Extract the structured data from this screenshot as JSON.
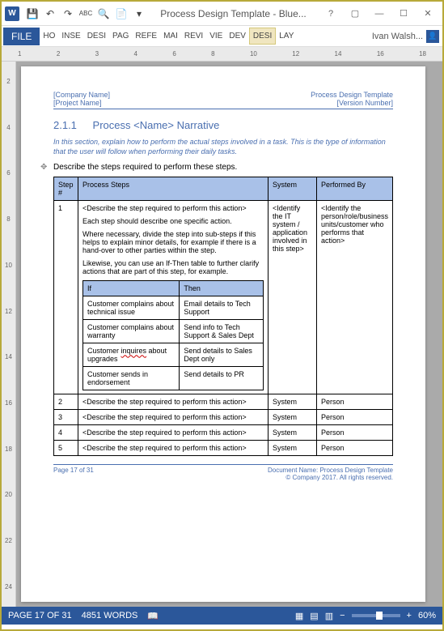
{
  "titlebar": {
    "title": "Process Design Template - Blue..."
  },
  "ribbon": {
    "file": "FILE",
    "tabs": [
      "HO",
      "INSE",
      "DESI",
      "PAG",
      "REFE",
      "MAI",
      "REVI",
      "VIE",
      "DEV",
      "DESI",
      "LAY"
    ],
    "user": "Ivan Walsh..."
  },
  "ruler_h": [
    "1",
    "2",
    "3",
    "4",
    "6",
    "8",
    "10",
    "12",
    "14",
    "16",
    "18"
  ],
  "ruler_v": [
    "2",
    "4",
    "6",
    "8",
    "10",
    "12",
    "14",
    "16",
    "18",
    "20",
    "22",
    "24"
  ],
  "doc": {
    "header": {
      "left1": "[Company Name]",
      "left2": "[Project Name]",
      "right1": "Process Design Template",
      "right2": "[Version Number]"
    },
    "section_num": "2.1.1",
    "section_title": "Process <Name> Narrative",
    "italic": "In this section, explain how to perform the actual steps involved in a task. This is the type of information that the user will follow when performing their daily tasks.",
    "intro": "Describe the steps required to perform these steps.",
    "table": {
      "headers": [
        "Step #",
        "Process Steps",
        "System",
        "Performed By"
      ],
      "row1": {
        "num": "1",
        "p1": "<Describe the step required to perform this action>",
        "p2": "Each step should describe one specific action.",
        "p3": "Where necessary, divide the step into sub-steps if this helps to explain minor details, for example if there is a hand-over to other parties within the step.",
        "p4": "Likewise, you can use an If-Then table to further clarify actions that are part of this step, for example.",
        "system": "<Identify the IT system / application involved in this step>",
        "performed": "<Identify the person/role/business units/customer who performs that action>",
        "inner": {
          "h1": "If",
          "h2": "Then",
          "rows": [
            {
              "if": "Customer complains about technical issue",
              "then": "Email details to Tech Support"
            },
            {
              "if": "Customer complains about warranty",
              "then": "Send info to Tech Support & Sales Dept"
            },
            {
              "if_a": "Customer ",
              "if_b": "inquires",
              "if_c": " about upgrades",
              "then": "Send details to Sales Dept only"
            },
            {
              "if": "Customer sends in endorsement",
              "then": "Send details to PR"
            }
          ]
        }
      },
      "rows": [
        {
          "num": "2",
          "step": "<Describe the step required to perform this action>",
          "sys": "System",
          "perf": "Person"
        },
        {
          "num": "3",
          "step": "<Describe the step required to perform this action>",
          "sys": "System",
          "perf": "Person"
        },
        {
          "num": "4",
          "step": "<Describe the step required to perform this action>",
          "sys": "System",
          "perf": "Person"
        },
        {
          "num": "5",
          "step": "<Describe the step required to perform this action>",
          "sys": "System",
          "perf": "Person"
        }
      ]
    },
    "footer": {
      "left": "Page 17 of 31",
      "right1": "Document Name: Process Design Template",
      "right2": "© Company 2017. All rights reserved."
    }
  },
  "status": {
    "page": "PAGE 17 OF 31",
    "words": "4851 WORDS",
    "zoom": "60%"
  }
}
